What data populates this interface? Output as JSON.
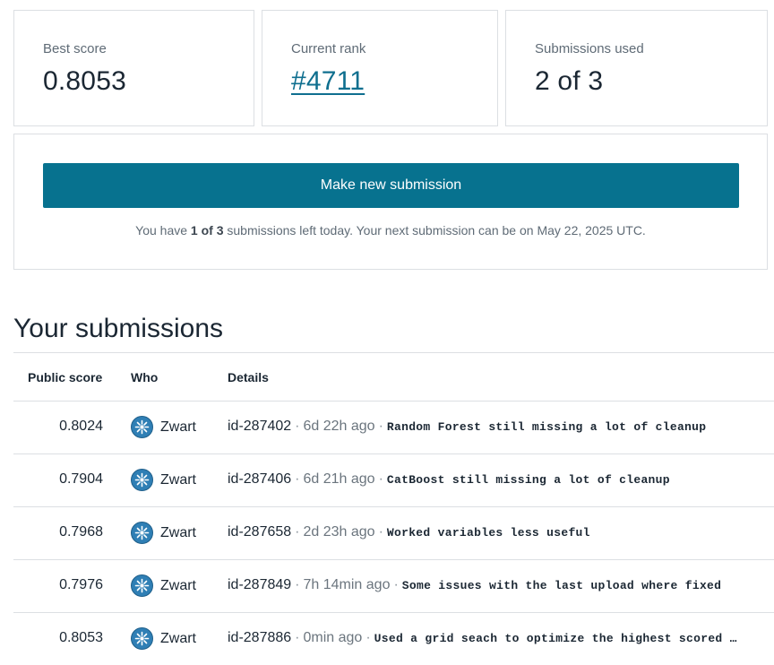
{
  "stats": {
    "best_score_label": "Best score",
    "best_score_value": "0.8053",
    "rank_label": "Current rank",
    "rank_value": "#4711",
    "submissions_label": "Submissions used",
    "submissions_value": "2 of 3"
  },
  "submit": {
    "button_label": "Make new submission",
    "note_prefix": "You have ",
    "note_bold": "1 of 3",
    "note_suffix": " submissions left today. Your next submission can be on May 22, 2025 UTC."
  },
  "section_title": "Your submissions",
  "table": {
    "headers": {
      "score": "Public score",
      "who": "Who",
      "details": "Details"
    },
    "separator": "·",
    "rows": [
      {
        "score": "0.8024",
        "who": "Zwart",
        "id": "id-287402",
        "ago": "6d 22h ago",
        "desc": "Random Forest still missing a lot of cleanup"
      },
      {
        "score": "0.7904",
        "who": "Zwart",
        "id": "id-287406",
        "ago": "6d 21h ago",
        "desc": "CatBoost still missing a lot of cleanup"
      },
      {
        "score": "0.7968",
        "who": "Zwart",
        "id": "id-287658",
        "ago": "2d 23h ago",
        "desc": "Worked variables less useful"
      },
      {
        "score": "0.7976",
        "who": "Zwart",
        "id": "id-287849",
        "ago": "7h 14min ago",
        "desc": "Some issues with the last upload where fixed"
      },
      {
        "score": "0.8053",
        "who": "Zwart",
        "id": "id-287886",
        "ago": "0min ago",
        "desc": "Used a grid seach to optimize the highest scored …"
      }
    ]
  },
  "icons": {
    "avatar": "avatar-icon"
  },
  "colors": {
    "accent": "#07728f",
    "link": "#0f6f8f",
    "border": "#dcdfe3"
  }
}
